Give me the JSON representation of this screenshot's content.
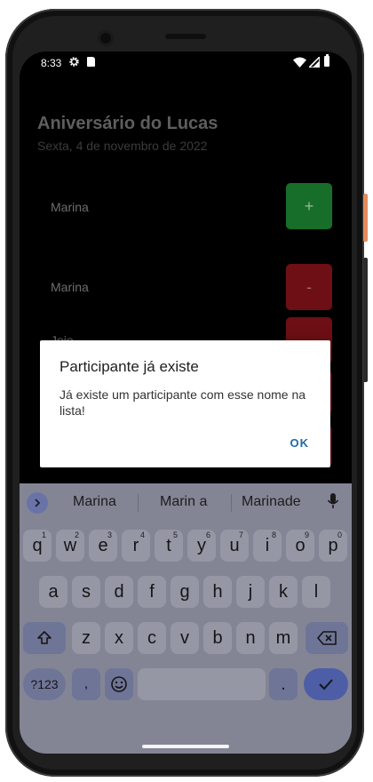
{
  "status_bar": {
    "time": "8:33",
    "icons": [
      "gear-icon",
      "sd-card-icon",
      "wifi-icon",
      "signal-icon",
      "battery-icon"
    ]
  },
  "app": {
    "title": "Aniversário do Lucas",
    "date": "Sexta, 4 de novembro de 2022",
    "input_value": "Marina",
    "add_button_label": "+",
    "participants": [
      {
        "name": "Marina",
        "remove_label": "-"
      },
      {
        "name": "Joio",
        "remove_label": ""
      }
    ],
    "colors": {
      "add": "#176e2a",
      "remove": "#6d0f15",
      "background": "#000000"
    }
  },
  "dialog": {
    "title": "Participante já existe",
    "message": "Já existe um participante com esse nome na lista!",
    "ok_label": "OK",
    "accent": "#1c6aa8"
  },
  "keyboard": {
    "suggestions": [
      "Marina",
      "Marin a",
      "Marinade"
    ],
    "row1": [
      {
        "key": "q",
        "hint": "1"
      },
      {
        "key": "w",
        "hint": "2"
      },
      {
        "key": "e",
        "hint": "3"
      },
      {
        "key": "r",
        "hint": "4"
      },
      {
        "key": "t",
        "hint": "5"
      },
      {
        "key": "y",
        "hint": "6"
      },
      {
        "key": "u",
        "hint": "7"
      },
      {
        "key": "i",
        "hint": "8"
      },
      {
        "key": "o",
        "hint": "9"
      },
      {
        "key": "p",
        "hint": "0"
      }
    ],
    "row2": [
      "a",
      "s",
      "d",
      "f",
      "g",
      "h",
      "j",
      "k",
      "l"
    ],
    "row3": [
      "z",
      "x",
      "c",
      "v",
      "b",
      "n",
      "m"
    ],
    "symbols_label": "?123",
    "comma_label": ",",
    "period_label": ".",
    "accent": "#4d5ea6"
  }
}
